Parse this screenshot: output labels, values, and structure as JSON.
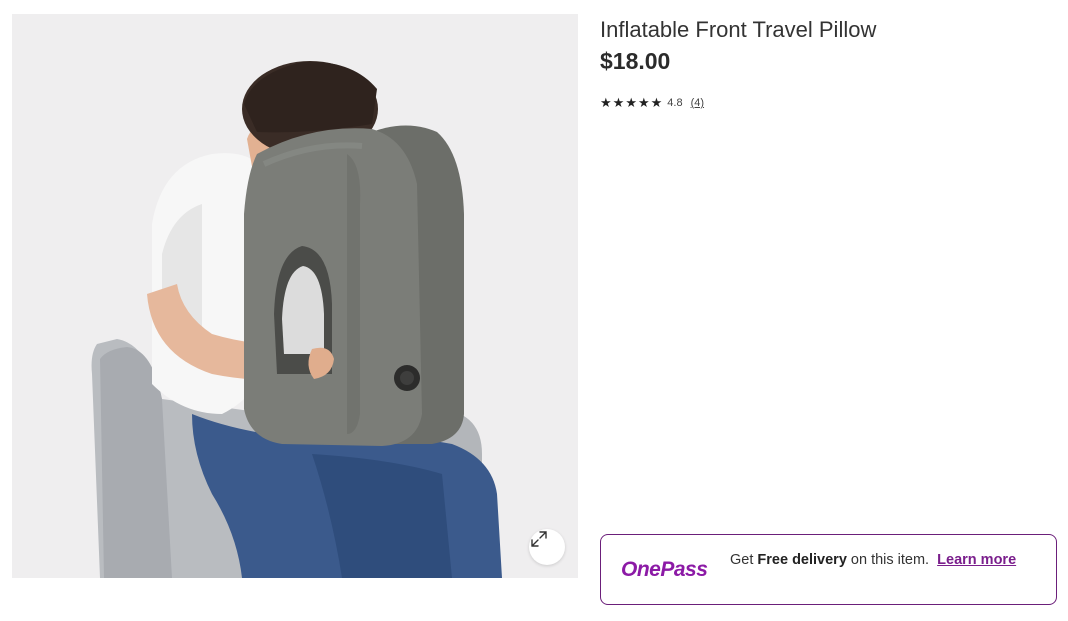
{
  "product": {
    "title": "Inflatable Front Travel Pillow",
    "price": "$18.00",
    "rating_value": "4.8",
    "rating_stars": 5,
    "review_count": "(4)"
  },
  "gallery": {
    "image_subject": "Person seated in a grey armchair leaning forward onto a grey inflatable front travel pillow",
    "expand_icon": "expand-arrows-icon"
  },
  "onepass": {
    "logo": "OnePass",
    "prefix": "Get ",
    "emphasis": "Free delivery",
    "suffix": " on this item.",
    "link_label": "Learn more"
  },
  "colors": {
    "brand_purple": "#8c1aa6",
    "border_purple": "#6b1f7a",
    "image_background": "#efeeef"
  }
}
